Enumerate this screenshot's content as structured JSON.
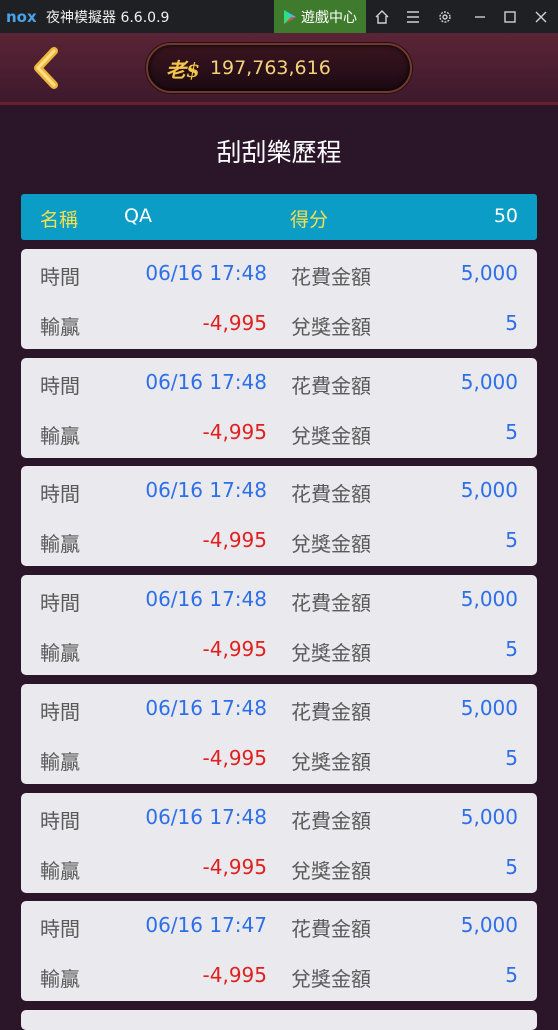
{
  "window": {
    "logo_text": "nox",
    "title": "夜神模擬器 6.6.0.9",
    "game_center_label": "遊戲中心"
  },
  "header": {
    "coin_logo": "老$",
    "balance": "197,763,616"
  },
  "page_title": "刮刮樂歷程",
  "summary": {
    "name_label": "名稱",
    "name_value": "QA",
    "score_label": "得分",
    "score_value": "50"
  },
  "record_labels": {
    "time": "時間",
    "win_loss": "輸贏",
    "cost": "花費金額",
    "prize": "兌獎金額"
  },
  "records": [
    {
      "time": "06/16 17:48",
      "win_loss": "-4,995",
      "cost": "5,000",
      "prize": "5"
    },
    {
      "time": "06/16 17:48",
      "win_loss": "-4,995",
      "cost": "5,000",
      "prize": "5"
    },
    {
      "time": "06/16 17:48",
      "win_loss": "-4,995",
      "cost": "5,000",
      "prize": "5"
    },
    {
      "time": "06/16 17:48",
      "win_loss": "-4,995",
      "cost": "5,000",
      "prize": "5"
    },
    {
      "time": "06/16 17:48",
      "win_loss": "-4,995",
      "cost": "5,000",
      "prize": "5"
    },
    {
      "time": "06/16 17:48",
      "win_loss": "-4,995",
      "cost": "5,000",
      "prize": "5"
    },
    {
      "time": "06/16 17:47",
      "win_loss": "-4,995",
      "cost": "5,000",
      "prize": "5"
    }
  ],
  "colors": {
    "summary_bg": "#0c9dc7",
    "label_gold": "#f4e04d",
    "value_blue": "#2d6fe8",
    "loss_red": "#e0201e",
    "card_bg": "#e9e9ee"
  }
}
